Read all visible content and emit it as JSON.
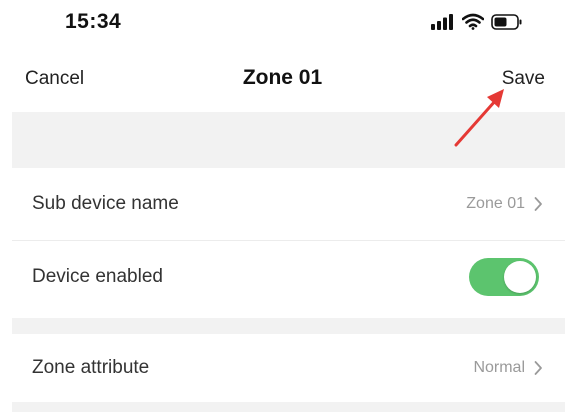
{
  "status_bar": {
    "time": "15:34",
    "icons": [
      "signal-icon",
      "wifi-icon",
      "battery-icon"
    ]
  },
  "nav": {
    "cancel_label": "Cancel",
    "title": "Zone 01",
    "save_label": "Save"
  },
  "settings": {
    "sub_device_name": {
      "label": "Sub device name",
      "value": "Zone 01"
    },
    "device_enabled": {
      "label": "Device enabled",
      "enabled": true
    },
    "zone_attribute": {
      "label": "Zone attribute",
      "value": "Normal"
    }
  },
  "colors": {
    "toggle_on": "#5cc46e",
    "annotation_arrow": "#e53935",
    "section_gap": "#f2f2f2"
  }
}
